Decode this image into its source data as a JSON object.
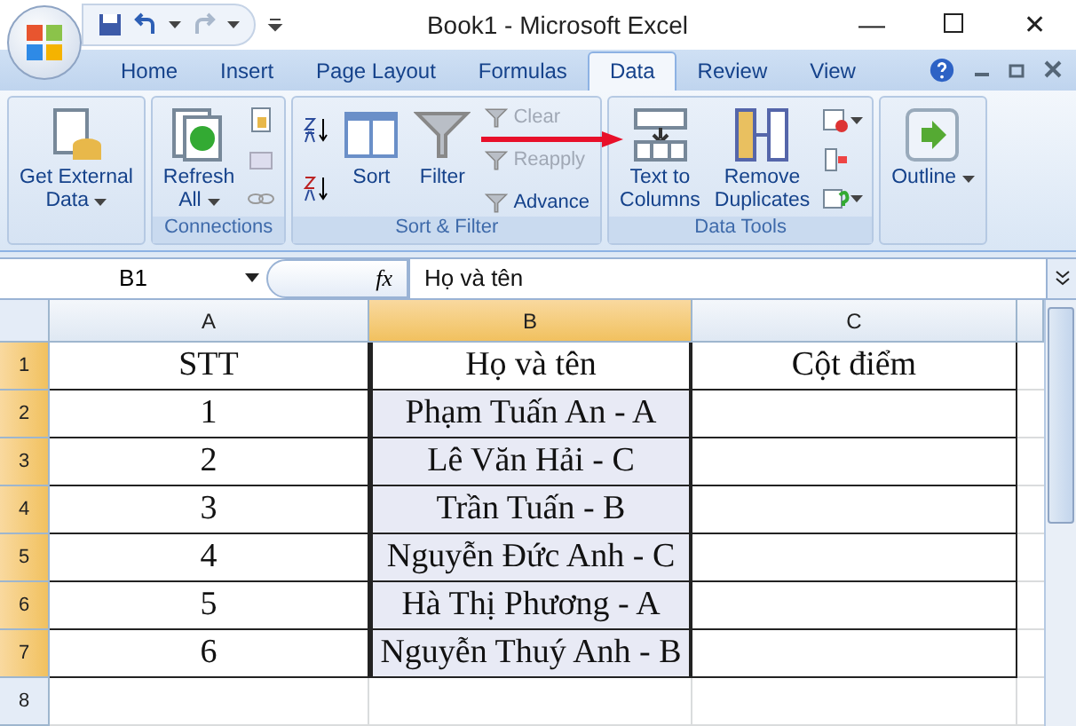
{
  "window": {
    "title": "Book1 - Microsoft Excel",
    "minimize": "—",
    "close": "✕"
  },
  "tabs": [
    {
      "label": "Home",
      "selected": false
    },
    {
      "label": "Insert",
      "selected": false
    },
    {
      "label": "Page Layout",
      "selected": false
    },
    {
      "label": "Formulas",
      "selected": false
    },
    {
      "label": "Data",
      "selected": true
    },
    {
      "label": "Review",
      "selected": false
    },
    {
      "label": "View",
      "selected": false
    }
  ],
  "ribbon": [
    {
      "items": [
        {
          "kind": "large",
          "lines": [
            "Get External",
            "Data"
          ],
          "dropdown": true
        }
      ]
    },
    {
      "group": "Connections",
      "items": [
        {
          "kind": "large",
          "lines": [
            "Refresh",
            "All"
          ],
          "dropdown": true
        },
        {
          "kind": "iconcol",
          "buttons": [
            {
              "dropdown": false
            },
            {
              "dropdown": false
            },
            {
              "dropdown": false
            }
          ]
        }
      ]
    },
    {
      "group": "Sort & Filter",
      "items": [
        {
          "kind": "iconcol",
          "buttons": [
            {
              "dropdown": false
            },
            {
              "dropdown": false
            }
          ]
        },
        {
          "kind": "large",
          "lines": [
            "Sort"
          ],
          "dropdown": false
        },
        {
          "kind": "large",
          "lines": [
            "Filter"
          ],
          "dropdown": false
        },
        {
          "kind": "smallcol",
          "entries": [
            {
              "label": "Clear",
              "disabled": true
            },
            {
              "label": "Reapply",
              "disabled": true
            },
            {
              "label": "Advance",
              "disabled": false
            }
          ]
        }
      ]
    },
    {
      "group": "Data Tools",
      "items": [
        {
          "kind": "large",
          "lines": [
            "Text to",
            "Columns"
          ],
          "dropdown": false
        },
        {
          "kind": "large",
          "lines": [
            "Remove",
            "Duplicates"
          ],
          "dropdown": false
        },
        {
          "kind": "iconcol",
          "buttons": [
            {
              "dropdown": true
            },
            {
              "dropdown": false
            },
            {
              "dropdown": true
            }
          ]
        }
      ]
    },
    {
      "items": [
        {
          "kind": "large",
          "lines": [
            "Outline"
          ],
          "dropdown": true
        }
      ]
    }
  ],
  "formula_bar": {
    "name_box": "B1",
    "fx": "fx",
    "value": "Họ và tên"
  },
  "columns": [
    {
      "label": "A",
      "selected": false
    },
    {
      "label": "B",
      "selected": true
    },
    {
      "label": "C",
      "selected": false
    }
  ],
  "rows": [
    {
      "number": "1",
      "selected": true,
      "shaded": false,
      "cells": [
        "STT",
        "Họ và tên",
        "Cột điểm"
      ]
    },
    {
      "number": "2",
      "selected": true,
      "shaded": true,
      "cells": [
        "1",
        "Phạm Tuấn An - A",
        ""
      ]
    },
    {
      "number": "3",
      "selected": true,
      "shaded": true,
      "cells": [
        "2",
        "Lê Văn Hải - C",
        ""
      ]
    },
    {
      "number": "4",
      "selected": true,
      "shaded": true,
      "cells": [
        "3",
        "Trần Tuấn - B",
        ""
      ]
    },
    {
      "number": "5",
      "selected": true,
      "shaded": true,
      "cells": [
        "4",
        "Nguyễn Đức Anh - C",
        ""
      ]
    },
    {
      "number": "6",
      "selected": true,
      "shaded": true,
      "cells": [
        "5",
        "Hà Thị Phương - A",
        ""
      ]
    },
    {
      "number": "7",
      "selected": true,
      "shaded": true,
      "cells": [
        "6",
        "Nguyễn Thuý Anh - B",
        ""
      ]
    },
    {
      "number": "8",
      "selected": false,
      "shaded": false,
      "cells": [
        "",
        "",
        ""
      ]
    }
  ]
}
